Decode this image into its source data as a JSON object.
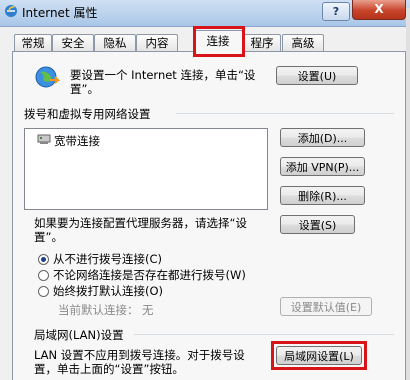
{
  "window": {
    "title": "Internet 属性",
    "help_label": "?",
    "close_label": "X"
  },
  "tabs": [
    {
      "label": "常规"
    },
    {
      "label": "安全"
    },
    {
      "label": "隐私"
    },
    {
      "label": "内容"
    },
    {
      "label": "连接",
      "active": true
    },
    {
      "label": "程序"
    },
    {
      "label": "高级"
    }
  ],
  "setup": {
    "text_line1": "要设置一个 Internet 连接，单击“设",
    "text_line2": "置”。",
    "button": "设置(U)"
  },
  "dialup": {
    "heading": "拨号和虚拟专用网络设置",
    "connections": [
      {
        "name": "宽带连接",
        "icon": "broadband-connection-icon"
      }
    ],
    "add_button": "添加(D)...",
    "add_vpn_button": "添加 VPN(P)...",
    "delete_button": "删除(R)...",
    "settings_button": "设置(S)",
    "proxy_text_line1": "如果要为连接配置代理服务器，请选择“设",
    "proxy_text_line2": "置”。",
    "options": [
      {
        "label": "从不进行拨号连接(C)",
        "checked": true
      },
      {
        "label": "不论网络连接是否存在都进行拨号(W)",
        "checked": false
      },
      {
        "label": "始终拨打默认连接(O)",
        "checked": false
      }
    ],
    "current_default_label": "当前默认连接：",
    "current_default_value": "无",
    "set_default_button": "设置默认值(E)"
  },
  "lan": {
    "heading": "局域网(LAN)设置",
    "text_line1": "LAN 设置不应用到拨号连接。对于拨号设",
    "text_line2": "置，单击上面的“设置”按钮。",
    "button": "局域网设置(L)"
  },
  "colors": {
    "highlight": "#d9131a",
    "radio_dot": "#1c3f8e"
  }
}
